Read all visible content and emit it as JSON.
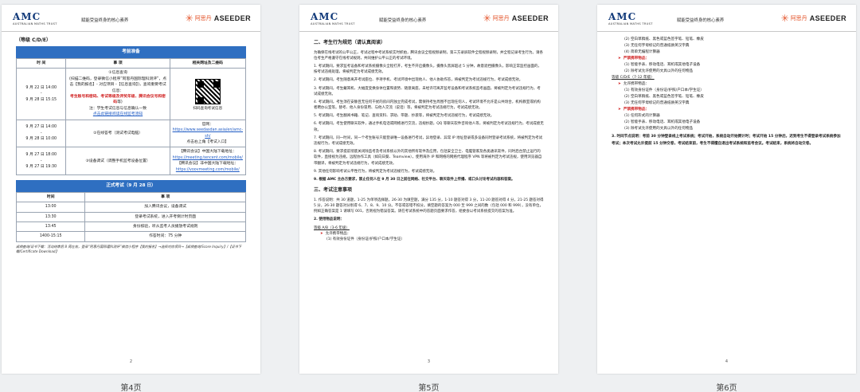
{
  "header": {
    "amc_mark": "AMC",
    "amc_sub": "AUSTRALIAN MATHS TRUST",
    "mid": "赋能受益终身的核心素养",
    "aseed_cn": "阿思丹",
    "aseed_en": "ASEEDER"
  },
  "pages": {
    "p4": {
      "label": "第4页",
      "num": "2"
    },
    "p5": {
      "label": "第5页",
      "num": "3"
    },
    "p6": {
      "label": "第6页",
      "num": "4"
    }
  },
  "page4": {
    "level": "（等级 C/D/E）",
    "prep_title": "考前准备",
    "cols": [
      "时 间",
      "事 项",
      "相关网址及二维码"
    ],
    "row1": {
      "time": "9 月 22 日 14:00\n-\n9 月 28 日 15:15",
      "a": "①信息查询",
      "b": "(扫描二维码，登录微信小程序“阿思丹国际理科测评”，点击【我的报名】- 对应项目 -【信息查询】)，查询重要考试信息：",
      "c": "考生账号和密码、考试等级及评奖年级、腾讯会议号和密码",
      "d": "等)",
      "e": "注：学生考试信息与信息确认一致",
      "f": "点击此链接阅读在线监考须知",
      "qr_caption": "扫码查询考试信息"
    },
    "row2": {
      "time": "9 月 27 日 14:00\n-\n9 月 28 日 10:00",
      "task": "②在线答考（测试考试电脑）",
      "site_label": "官网：",
      "site_url": "https://www.seedasdan.asia/en/amc-sh/",
      "site_tip": "点击右上角【考试入口】"
    },
    "row3": {
      "time": "9 月 27 日 18:00\n-\n9 月 27 日 19:30",
      "task": "③设备调试（调整手机监考设备位置）",
      "tm_cn": "【腾讯会议】中国大陆下载地址：",
      "tm_cn_url": "https://meeting.tencent.com/mobile/",
      "tm_intl": "【腾讯会议】非中国大陆下载地址：",
      "tm_intl_url": "https://voovmeeting.com/mobile/"
    },
    "exam_title": "正式考试（9 月 28 日）",
    "exam_cols": [
      "时间",
      "事 项"
    ],
    "exam_rows": [
      {
        "time": "13:00",
        "task": "加入腾讯会议，设备调试"
      },
      {
        "time": "13:30",
        "task": "登录考试系统，进入开考倒计时页面"
      },
      {
        "time": "13:45",
        "task": "身份核验，听从监考人员播放考试规则"
      },
      {
        "time": "1400-15:15",
        "task": "作答时间：75 分钟"
      }
    ],
    "note": "成绩查询/证书下载：活动结束后 8 周左右，登录“阿思丹国际理科测评”微信小程序【我的报名】→选择对应项目→【成绩查询/Score Inquiry】/【证书下载/Certificate Download】"
  },
  "page5": {
    "sec2": "二、考生行为规范（请认真阅读）",
    "intro": "为确保在线考试的公平公正，考试过程中考试系统实时抓拍，腾讯会议全程视频录制，第三方录屏软件全程视频录制，并全程记录考生行为。请各位考生严格遵守在线考试规则，共同维护公平公正的考试环境。",
    "rules": [
      "1. 考试期间，要求监考设备和考试系统摄像头全程打开，考生不开启摄像头，摄像头黑屏超过 5 分钟，故意遮挡摄像头，影响正常监控画面的，按考试违规处理，将被判定为考试成绩无效。",
      "2. 考试期间，考生随意离开考试座位、手持手机、考试环境中出现他人、他人协助作答，将被判定为考试违规行为，考试成绩无效。",
      "3. 考试期间，考生戴耳机、大幅度变换身体位置和姿势、随意离座，未经许可离开监考设备和考试系统监考画面，将被判定为考试违规行为，考试成绩无效。",
      "4. 考试期间，考生须在安静且无任何干扰的房间内独立完成考试，需保持考生周围不出现任何人，考试环境不允许是公共场合，机构教室或机构者聘办公室等。替考、他人身份冒用、与他人交流（说话）等，将被判定为考试违规行为，考试成绩无效。",
      "5. 考试期间，考生翻阅书籍、笔记、查询资料、求助、带题、抄袭等，将被判定为考试违规行为，考试成绩无效。",
      "6. 考试期间，考生使用聊天软件，通过手机电话或网络进行交流，违规抄题，QQ 等聊天软件咨询他人等，将被判定为考试违规行为，考试成绩无效。",
      "7. 考试期间，同一时间，同一个考生账号只能登录唯一设备进行考试，异地登录、异常 IP 地址登录或多设备同时登录考试系统，将被判定为考试违规行为，考试成绩无效。",
      "8. 考试期间，要求提前彻底关闭除监考及考试系统以外的其他所有软件及应用，包括安全卫士、电脑管家及各类通讯软件，同时后台禁止运行的软件，直接视为违规，远程协作工具（如向日葵、Teamview），使用海外 IP 和网络的网络代理程序 VPN 等将被判定为考试违规，使用浏览器自带翻译，将被判定为考试违规行为，考试成绩无效。",
      "9. 其他任何影响考试公平性行为，将被判定为考试违规行为，考试成绩无效。",
      "9. 根据 AMC 主办方要求，禁止任何人在 9 月 30 日之前在网络、社交平台、聊天软件上传播、或口头讨论考试内容和答案。"
    ],
    "sec3": "三、考试注意事项",
    "note1": "1. 作答说明：共 30 道题，1-25 为单项选择题，26-30 为填空题，满分 135 分，1-10 题答对得 3 分，11-20 题答对得 4 分，21-25 题答对得 5 分，26-30 题答对分别得 6、7、8、9、10 分。不答或答错不扣分。填空题的答案为 000 至 999 之间的数（包括 000 和 999），没有单位，例如正确答案是 1 请填写 001，否则视为错误答案。请在考试系统中的答题页面要求作答，组委会以考试系统提交的答案为准。",
    "note2": "2. 使用物品说明：",
    "level_ab": "等级 A/B（3-6 年级）",
    "allow": "允许携带物品：",
    "item1": "(1) 有效身份证件（身份证/护照/户口本/学生证）"
  },
  "page6": {
    "items_top": [
      "(2) 空白草稿纸、黑色或蓝色签字笔、铅笔、橡皮",
      "(3) 无任何字母标记的普通纸质英汉字典",
      "(4) 简单无编程计算器"
    ],
    "forbid": "严禁携带物品：",
    "forbid_items": [
      "(1) 智能手表、移动电话、耳机或其他电子设备",
      "(2) 除考试允许使用的文具以外的任何物品"
    ],
    "level_cde": "等级 C/D/E（7-12 年级）",
    "allow": "允许携带物品：",
    "allow_items": [
      "(1) 有效身份证件（身份证/护照/户口本/学生证）",
      "(2) 空白草稿纸、黑色或蓝色签字笔、铅笔、橡皮",
      "(3) 无任何字母标记的普通纸质英汉字典"
    ],
    "forbid2": "严禁携带物品：",
    "forbid2_items": [
      "(1) 任何形式的计算器",
      "(2) 智能手表、移动电话、耳机或其他电子设备",
      "(3) 除考试允许使用的文具以外的任何物品"
    ],
    "note3": "3. 时间节点说明：考前 30 分钟登录线上考试系统；考试开始，系统自动开始倒计时；考试开始 15 分钟后，迟到考生不得登录考试系统参加考试；本次考试允许提前 15 分钟交卷，考试结束前，考生不得擅自退出考试系统和监考会议。考试结束，系统将自动交卷。"
  }
}
